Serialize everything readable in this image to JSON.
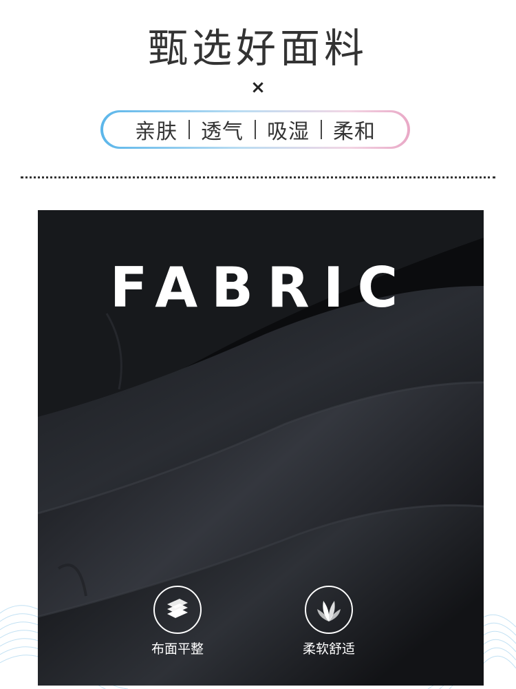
{
  "header": {
    "title": "甄选好面料",
    "cross_symbol": "×",
    "properties": [
      "亲肤",
      "透气",
      "吸湿",
      "柔和"
    ]
  },
  "photo": {
    "title": "FABRIC",
    "features": [
      {
        "icon": "flat-layers-icon",
        "label": "布面平整"
      },
      {
        "icon": "leaf-sprout-icon",
        "label": "柔软舒适"
      }
    ]
  },
  "colors": {
    "text": "#333333",
    "fabric": "#0b0c0e",
    "pill_gradient_start": "#5bb6ea",
    "pill_gradient_end": "#e9a8c6",
    "wave_accent": "#8fc8ea"
  }
}
